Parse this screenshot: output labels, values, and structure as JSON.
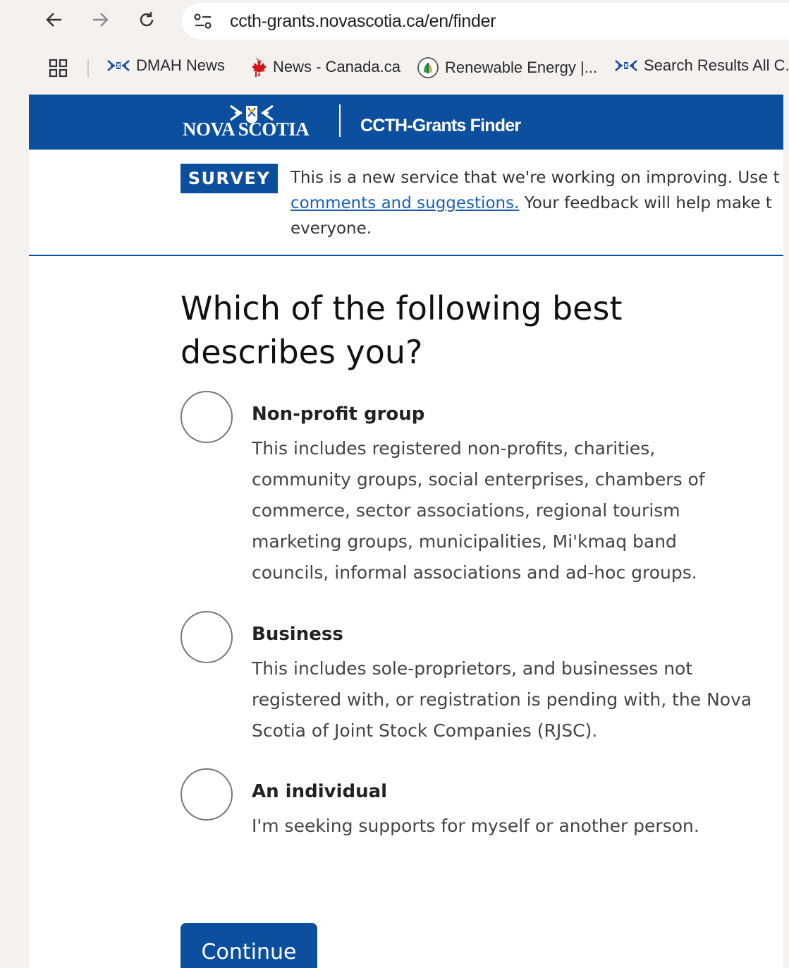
{
  "browser": {
    "url": "ccth-grants.novascotia.ca/en/finder",
    "bookmarks": [
      {
        "label": "DMAH News",
        "icon": "ns-flag-icon"
      },
      {
        "label": "News - Canada.ca",
        "icon": "maple-leaf-icon"
      },
      {
        "label": "Renewable Energy |...",
        "icon": "renewable-energy-icon"
      },
      {
        "label": "Search Results All C...",
        "icon": "ns-flag-icon"
      }
    ]
  },
  "header": {
    "logo_text": "NOVA SCOTIA",
    "title": "CCTH-Grants Finder",
    "color": "#0c4f9e"
  },
  "survey": {
    "badge": "SURVEY",
    "line1": "This is a new service that we're working on improving. Use t",
    "link": "comments and suggestions.",
    "line2_rest": " Your feedback will help make t",
    "line3": "everyone."
  },
  "question": {
    "line1": "Which of the following best",
    "line2": "describes you?"
  },
  "options": [
    {
      "title": "Non-profit group",
      "description": "This includes registered non-profits, charities, community groups, social enterprises, chambers of commerce, sector associations, regional tourism marketing groups, municipalities, Mi'kmaq band councils, informal associations and ad-hoc groups."
    },
    {
      "title": "Business",
      "description": "This includes sole-proprietors, and businesses not registered with, or registration is pending with, the Nova Scotia of Joint Stock Companies (RJSC)."
    },
    {
      "title": "An individual",
      "description": "I'm seeking supports for myself or another person."
    }
  ],
  "continue_label": "Continue"
}
